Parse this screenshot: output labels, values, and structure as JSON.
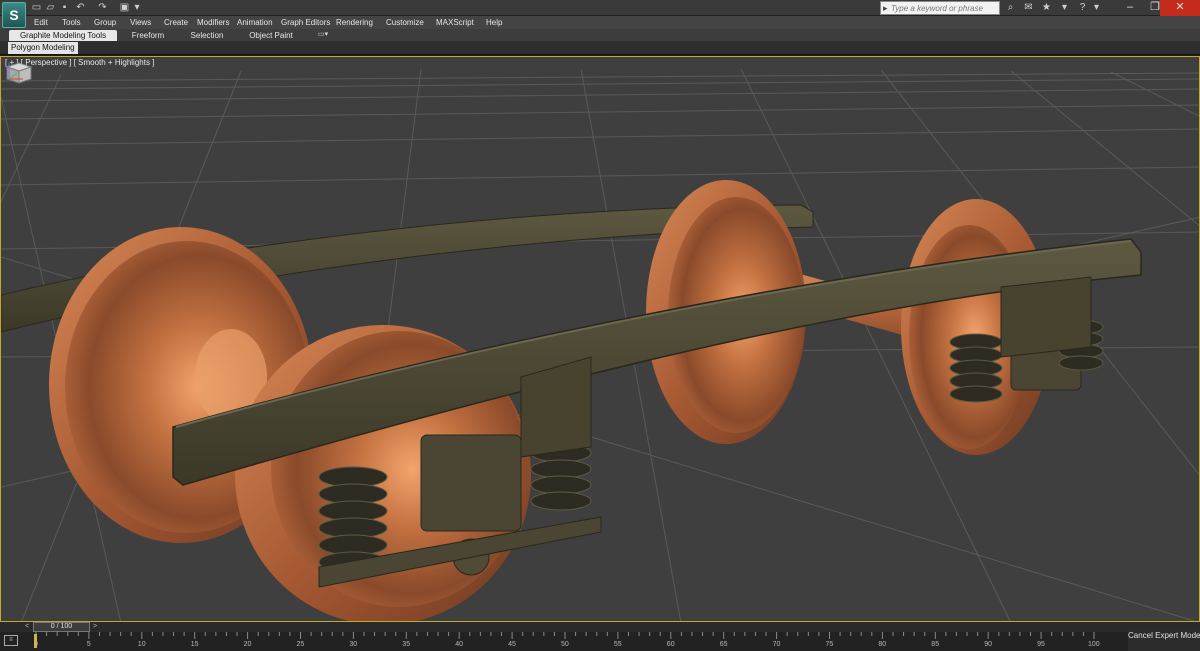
{
  "titlebar": {
    "logo": "S",
    "quick_access": [
      "new-icon",
      "open-icon",
      "save-icon",
      "undo-icon",
      "redo-icon",
      "project-icon"
    ],
    "search_placeholder": "Type a keyword or phrase",
    "right_icons": [
      "binoculars-icon",
      "communication-icon",
      "star-icon",
      "help-icon"
    ]
  },
  "menu": [
    "Edit",
    "Tools",
    "Group",
    "Views",
    "Create",
    "Modifiers",
    "Animation",
    "Graph Editors",
    "Rendering",
    "Customize",
    "MAXScript",
    "Help"
  ],
  "ribbon": {
    "tabs": [
      "Graphite Modeling Tools",
      "Freeform",
      "Selection",
      "Object Paint"
    ],
    "active_tab": "Graphite Modeling Tools",
    "panel_label": "Polygon Modeling"
  },
  "viewport": {
    "label": "[ + ] [ Perspective ] [ Smooth + Highlights ]"
  },
  "timeline": {
    "current": "0 / 100",
    "ticks": [
      "0",
      "5",
      "10",
      "15",
      "20",
      "25",
      "30",
      "35",
      "40",
      "45",
      "50",
      "55",
      "60",
      "65",
      "70",
      "75",
      "80",
      "85",
      "90",
      "95",
      "100"
    ]
  },
  "status": {
    "expert_mode": "Cancel Expert Mode"
  },
  "colors": {
    "wheel": "#c77a4a",
    "frame": "#4a4633",
    "viewport_bg": "#3f3f3f",
    "viewport_border": "#c8a632"
  }
}
